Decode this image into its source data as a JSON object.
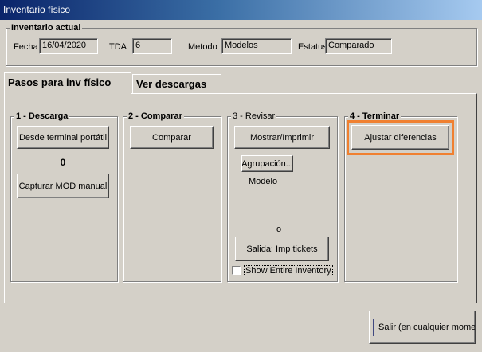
{
  "window": {
    "title": "Inventario físico"
  },
  "current": {
    "legend": "Inventario actual",
    "fecha_label": "Fecha",
    "fecha_value": "16/04/2020",
    "tda_label": "TDA",
    "tda_value": "6",
    "metodo_label": "Metodo",
    "metodo_value": "Modelos",
    "estatus_label": "Estatus",
    "estatus_value": "Comparado"
  },
  "tabs": [
    {
      "label": "Pasos para inv físico",
      "active": true
    },
    {
      "label": "Ver descargas",
      "active": false
    }
  ],
  "steps": {
    "descarga": {
      "legend": "1 - Descarga",
      "btn_terminal": "Desde terminal portátil",
      "count": "0",
      "btn_manual": "Capturar MOD manual"
    },
    "comparar": {
      "legend": "2 - Comparar",
      "btn": "Comparar"
    },
    "revisar": {
      "legend": "3 - Revisar",
      "btn_mostrar": "Mostrar/Imprimir",
      "btn_agrupacion": "Agrupación...",
      "agrupacion_value": "Modelo",
      "count": "o",
      "btn_salida": "Salida: Imp tickets",
      "chk_label": "Show Entire Inventory"
    },
    "terminar": {
      "legend": "4 - Terminar",
      "btn": "Ajustar diferencias"
    }
  },
  "footer": {
    "exit_label": "Salir (en cualquier momento)"
  },
  "colors": {
    "highlight": "#f08030",
    "title_start": "#0a246a"
  }
}
